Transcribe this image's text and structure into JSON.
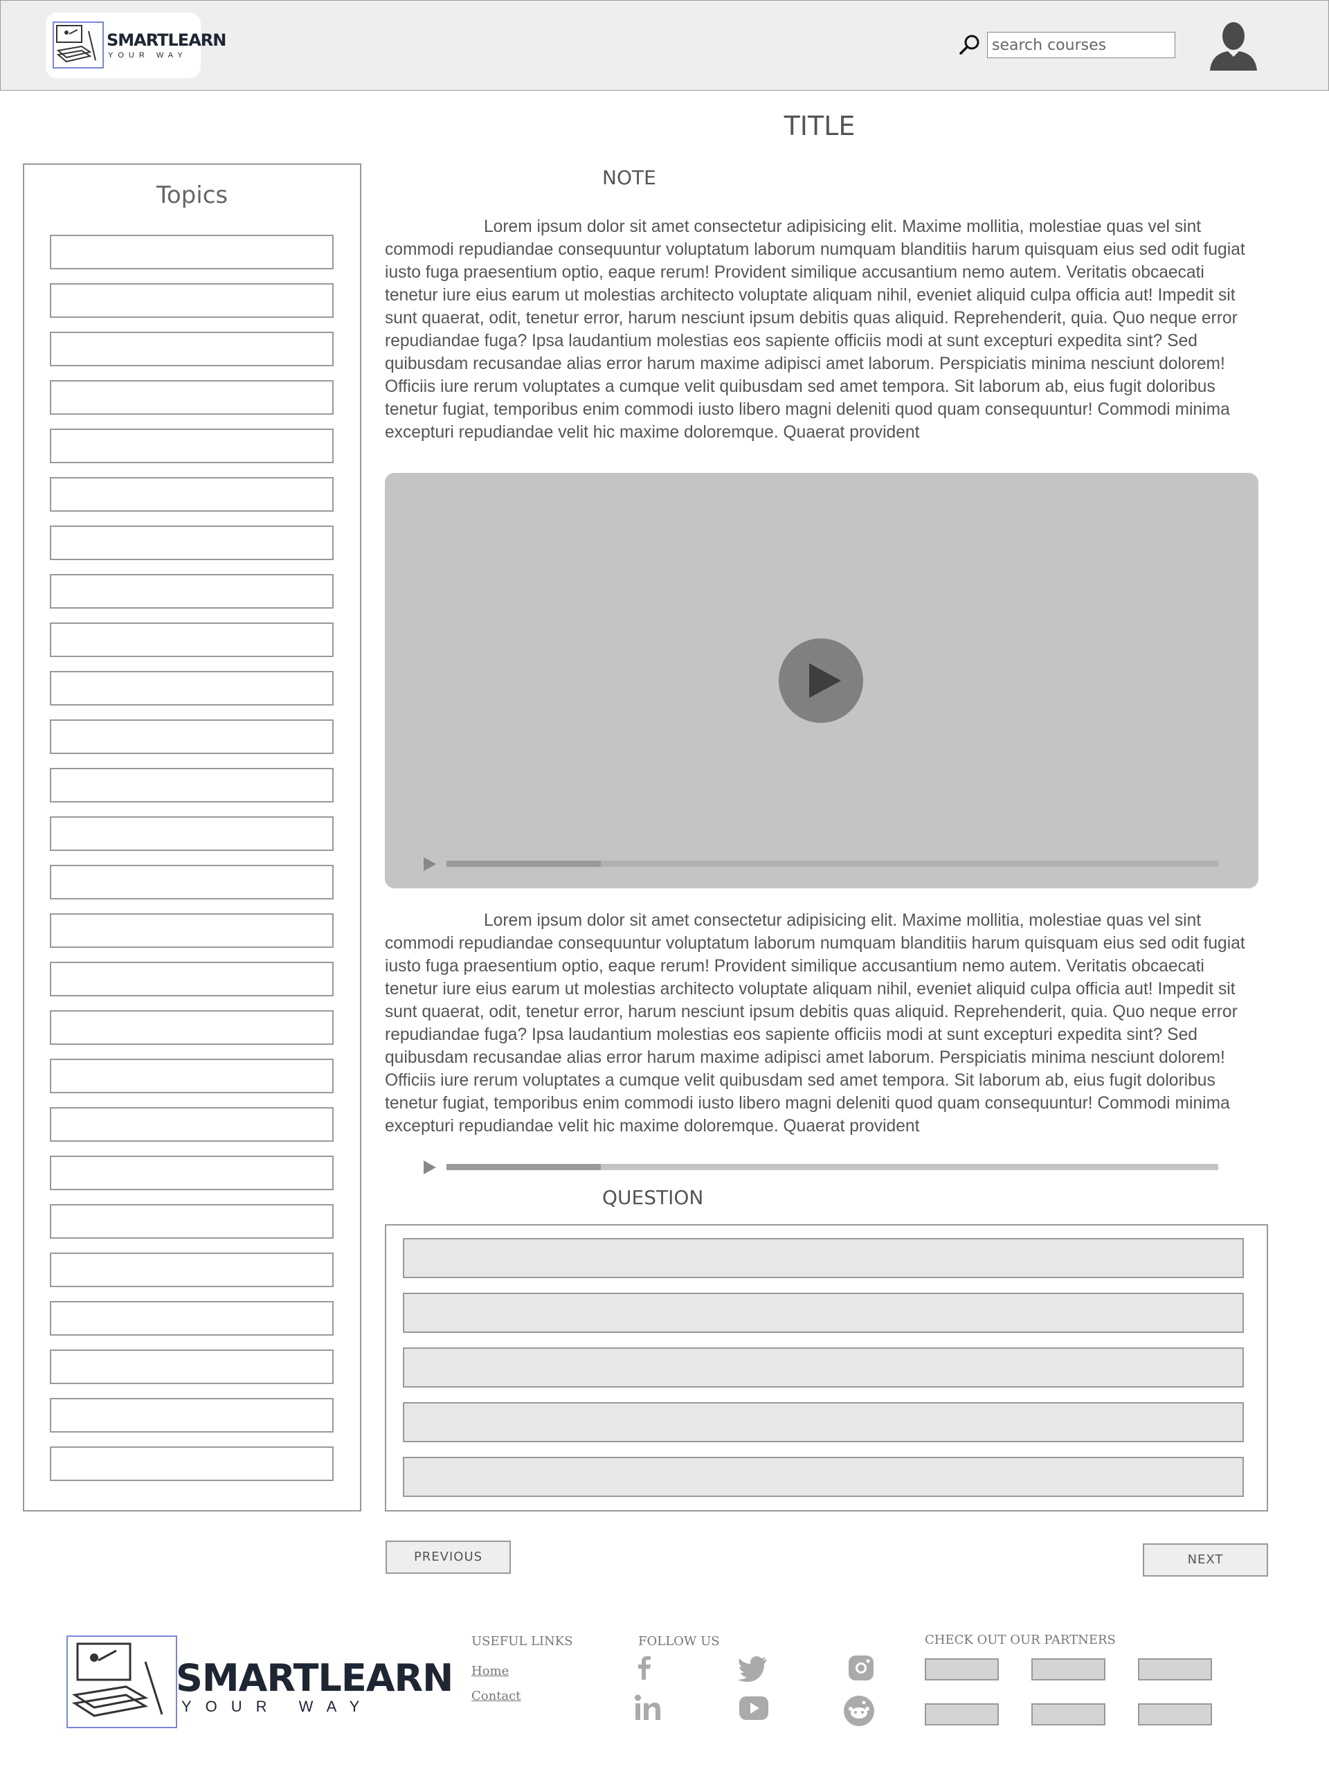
{
  "header": {
    "logo": {
      "word": "SMARTLEARN",
      "tagline": "YOUR WAY"
    },
    "search": {
      "placeholder": "search courses",
      "value": ""
    }
  },
  "page_title": "TITLE",
  "sidebar": {
    "title": "Topics",
    "items": [
      "",
      "",
      "",
      "",
      "",
      "",
      "",
      "",
      "",
      "",
      "",
      "",
      "",
      "",
      "",
      "",
      "",
      "",
      "",
      "",
      "",
      "",
      "",
      "",
      "",
      ""
    ]
  },
  "note": {
    "label": "NOTE",
    "paragraph_1": "Lorem ipsum dolor sit amet consectetur adipisicing elit. Maxime mollitia, molestiae quas vel sint commodi repudiandae consequuntur voluptatum laborum numquam blanditiis harum quisquam eius sed odit fugiat iusto fuga praesentium optio, eaque rerum! Provident similique accusantium nemo autem. Veritatis obcaecati tenetur iure eius earum ut molestias architecto voluptate aliquam nihil, eveniet aliquid culpa officia aut! Impedit sit sunt quaerat, odit, tenetur error, harum nesciunt ipsum debitis quas aliquid. Reprehenderit, quia. Quo neque error repudiandae fuga? Ipsa laudantium molestias eos sapiente officiis modi at sunt excepturi expedita sint?  Sed quibusdam recusandae alias error harum maxime adipisci amet laborum. Perspiciatis minima nesciunt dolorem! Officiis iure rerum voluptates a cumque velit quibusdam sed amet tempora. Sit laborum ab, eius fugit doloribus tenetur fugiat, temporibus enim commodi iusto libero magni deleniti quod quam consequuntur! Commodi minima excepturi repudiandae velit hic maxime doloremque. Quaerat provident",
    "paragraph_2": "Lorem ipsum dolor sit amet consectetur adipisicing elit. Maxime mollitia, molestiae quas vel sint commodi repudiandae consequuntur voluptatum laborum numquam blanditiis harum quisquam eius sed odit fugiat iusto fuga praesentium optio, eaque rerum! Provident similique accusantium nemo autem. Veritatis obcaecati tenetur iure eius earum ut molestias architecto voluptate aliquam nihil, eveniet aliquid culpa officia aut! Impedit sit sunt quaerat, odit, tenetur error, harum nesciunt ipsum debitis quas aliquid. Reprehenderit, quia. Quo neque error repudiandae fuga? Ipsa laudantium molestias eos sapiente officiis modi at sunt excepturi expedita sint?  Sed quibusdam recusandae alias error harum maxime adipisci amet laborum. Perspiciatis minima nesciunt dolorem! Officiis iure rerum voluptates a cumque velit quibusdam sed amet tempora. Sit laborum ab, eius fugit doloribus tenetur fugiat, temporibus enim commodi iusto libero magni deleniti quod quam consequuntur! Commodi minima excepturi repudiandae velit hic maxime doloremque. Quaerat provident"
  },
  "video": {
    "icon": "play-icon",
    "progress": 0.2
  },
  "audio": {
    "icon": "play-icon",
    "progress": 0.2
  },
  "question": {
    "label": "QUESTION",
    "options": [
      "",
      "",
      "",
      "",
      ""
    ]
  },
  "navigation": {
    "previous_label": "PREVIOUS",
    "next_label": "NEXT"
  },
  "footer": {
    "logo": {
      "word": "SMARTLEARN",
      "tagline": "YOUR WAY"
    },
    "useful_links": {
      "heading": "USEFUL LINKS",
      "links": [
        "Home",
        "Contact"
      ]
    },
    "follow_us": {
      "heading": "FOLLOW US",
      "icons": [
        "facebook-icon",
        "twitter-icon",
        "instagram-icon",
        "linkedin-icon",
        "youtube-icon",
        "reddit-icon"
      ]
    },
    "partners": {
      "heading": "CHECK OUT OUR PARTNERS",
      "count": 6
    }
  },
  "colors": {
    "header_bg": "#eeeeee",
    "border": "#999999",
    "video_bg": "#c4c4c4",
    "progress_fill": "#a0a0a0",
    "logo_text": "#1e2633",
    "logo_frame": "#7a86d6"
  }
}
